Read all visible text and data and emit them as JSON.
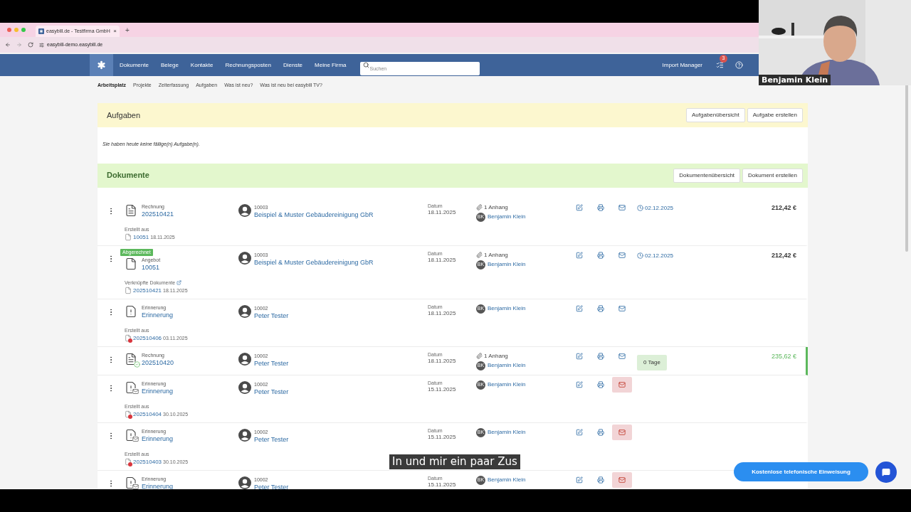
{
  "browser": {
    "tab_title": "easybill.de - Testfirma GmbH",
    "tab_close": "×",
    "new_tab": "+",
    "url": "easybill-demo.easybill.de"
  },
  "nav": {
    "items": [
      "Dokumente",
      "Belege",
      "Kontakte",
      "Rechnungsposten",
      "Dienste",
      "Meine Firma"
    ],
    "search_placeholder": "Suchen",
    "import_manager": "Import Manager",
    "tasks_badge": "3"
  },
  "subnav": [
    {
      "label": "Arbeitsplatz",
      "selected": true
    },
    {
      "label": "Projekte",
      "selected": false
    },
    {
      "label": "Zeiterfassung",
      "selected": false
    },
    {
      "label": "Aufgaben",
      "selected": false
    },
    {
      "label": "Was ist neu?",
      "selected": false
    },
    {
      "label": "Was ist neu bei easybill TV?",
      "selected": false
    }
  ],
  "tasks_panel": {
    "title": "Aufgaben",
    "buttons": [
      "Aufgabenübersicht",
      "Aufgabe erstellen"
    ],
    "message": "Sie haben heute keine fällige(n) Aufgabe(n)."
  },
  "documents_panel": {
    "title": "Dokumente",
    "buttons": [
      "Dokumentenübersicht",
      "Dokument erstellen"
    ],
    "rows": [
      {
        "kind": "invoice",
        "paid": false,
        "type": "Rechnung",
        "number": "202510421",
        "linked": {
          "label": "Erstellt aus",
          "external": false,
          "number": "10051",
          "date": "18.11.2025",
          "overdue": false
        },
        "customer_no": "10003",
        "customer": "Beispiel & Muster Gebäudereinigung GbR",
        "date_label": "Datum",
        "date": "18.11.2025",
        "attachment": "1 Anhang",
        "initials": "BK",
        "assignee": "Benjamin Klein",
        "mail_alert": false,
        "due": {
          "kind": "date",
          "text": "02.12.2025"
        },
        "amount": "212,42 €"
      },
      {
        "badge": "Abgerechnet",
        "kind": "offer",
        "paid": false,
        "type": "Angebot",
        "number": "10051",
        "linked": {
          "label": "Verknüpfte Dokumente",
          "external": true,
          "number": "202510421",
          "date": "18.11.2025",
          "overdue": false
        },
        "customer_no": "10003",
        "customer": "Beispiel & Muster Gebäudereinigung GbR",
        "date_label": "Datum",
        "date": "18.11.2025",
        "attachment": "1 Anhang",
        "initials": "BK",
        "assignee": "Benjamin Klein",
        "mail_alert": false,
        "due": {
          "kind": "date",
          "text": "02.12.2025"
        },
        "amount": "212,42 €"
      },
      {
        "kind": "reminder",
        "paid": false,
        "type": "Erinnerung",
        "number": "Erinnerung",
        "linked": {
          "label": "Erstellt aus",
          "external": false,
          "number": "202510406",
          "date": "03.11.2025",
          "overdue": true
        },
        "customer_no": "10002",
        "customer": "Peter Tester",
        "date_label": "Datum",
        "date": "18.11.2025",
        "initials": "BK",
        "assignee": "Benjamin Klein",
        "mail_alert": false
      },
      {
        "kind": "invoice",
        "paid": true,
        "type": "Rechnung",
        "number": "202510420",
        "customer_no": "10002",
        "customer": "Peter Tester",
        "date_label": "Datum",
        "date": "18.11.2025",
        "attachment": "1 Anhang",
        "initials": "BK",
        "assignee": "Benjamin Klein",
        "mail_alert": false,
        "due": {
          "kind": "days",
          "text": "0 Tage"
        },
        "amount": "235,62 €"
      },
      {
        "kind": "reminder_sent",
        "paid": false,
        "type": "Erinnerung",
        "number": "Erinnerung",
        "linked": {
          "label": "Erstellt aus",
          "external": false,
          "number": "202510404",
          "date": "30.10.2025",
          "overdue": true
        },
        "customer_no": "10002",
        "customer": "Peter Tester",
        "date_label": "Datum",
        "date": "15.11.2025",
        "initials": "BK",
        "assignee": "Benjamin Klein",
        "mail_alert": true
      },
      {
        "kind": "reminder_sent",
        "paid": false,
        "type": "Erinnerung",
        "number": "Erinnerung",
        "linked": {
          "label": "Erstellt aus",
          "external": false,
          "number": "202510403",
          "date": "30.10.2025",
          "overdue": true
        },
        "customer_no": "10002",
        "customer": "Peter Tester",
        "date_label": "Datum",
        "date": "15.11.2025",
        "initials": "BK",
        "assignee": "Benjamin Klein",
        "mail_alert": true
      },
      {
        "kind": "reminder_sent",
        "paid": false,
        "type": "Erinnerung",
        "number": "Erinnerung",
        "customer_no": "10002",
        "customer": "Peter Tester",
        "date_label": "Datum",
        "date": "15.11.2025",
        "initials": "BK",
        "assignee": "Benjamin Klein",
        "mail_alert": true
      }
    ]
  },
  "video": {
    "name": "Benjamin Klein"
  },
  "caption": "In und mir ein paar Zus",
  "help_button": "Kostenlose telefonische Einweisung"
}
